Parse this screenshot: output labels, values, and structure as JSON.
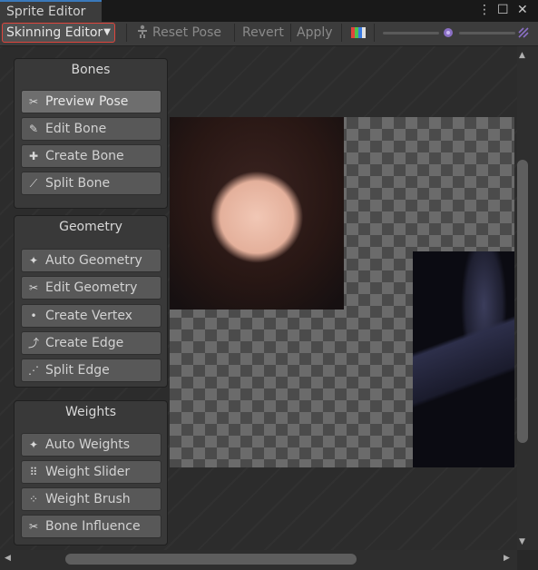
{
  "window": {
    "title": "Sprite Editor"
  },
  "window_controls": {
    "more": "⋮",
    "maximize": "☐",
    "close": "✕"
  },
  "toolbar": {
    "mode": "Skinning Editor",
    "reset_pose": "Reset Pose",
    "revert": "Revert",
    "apply": "Apply"
  },
  "panels": {
    "bones": {
      "title": "Bones",
      "items": [
        "Preview Pose",
        "Edit Bone",
        "Create Bone",
        "Split Bone"
      ]
    },
    "geometry": {
      "title": "Geometry",
      "items": [
        "Auto Geometry",
        "Edit Geometry",
        "Create Vertex",
        "Create Edge",
        "Split Edge"
      ]
    },
    "weights": {
      "title": "Weights",
      "items": [
        "Auto Weights",
        "Weight Slider",
        "Weight Brush",
        "Bone Influence"
      ]
    }
  },
  "colors": {
    "accent": "#3a79bb",
    "highlight_border": "#e0453c"
  }
}
